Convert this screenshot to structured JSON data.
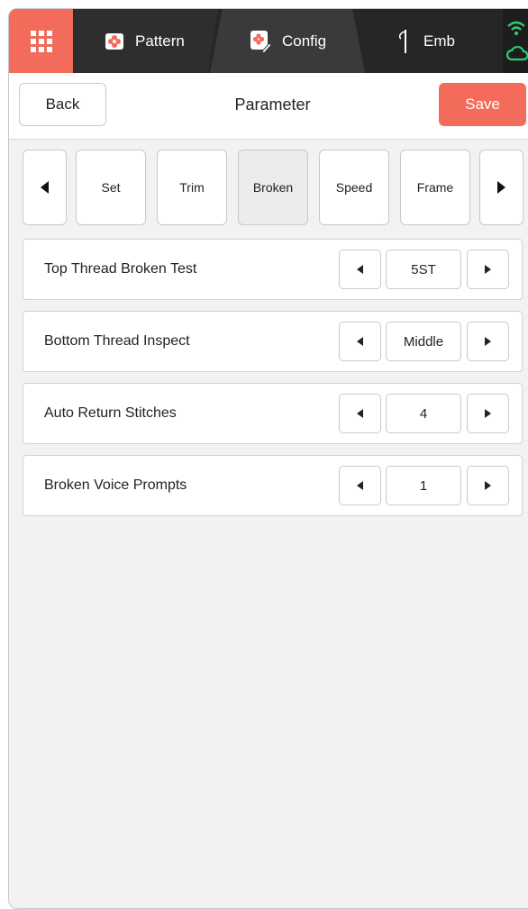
{
  "topbar": {
    "home_icon": "apps-grid-icon",
    "tabs": [
      {
        "label": "Pattern",
        "icon": "flower-card-icon"
      },
      {
        "label": "Config",
        "icon": "flower-edit-icon"
      },
      {
        "label": "Emb",
        "icon": "needle-thread-icon"
      }
    ],
    "status_icons": [
      "wifi-icon",
      "cloud-icon"
    ],
    "accent": "#f36b5b",
    "status_color": "#2ecc71"
  },
  "header": {
    "back_label": "Back",
    "title": "Parameter",
    "save_label": "Save"
  },
  "categories": {
    "items": [
      "Set",
      "Trim",
      "Broken",
      "Speed",
      "Frame"
    ],
    "active": "Broken"
  },
  "params": [
    {
      "label": "Top Thread Broken Test",
      "value": "5ST"
    },
    {
      "label": "Bottom Thread Inspect",
      "value": "Middle"
    },
    {
      "label": "Auto Return Stitches",
      "value": "4"
    },
    {
      "label": "Broken Voice Prompts",
      "value": "1"
    }
  ]
}
